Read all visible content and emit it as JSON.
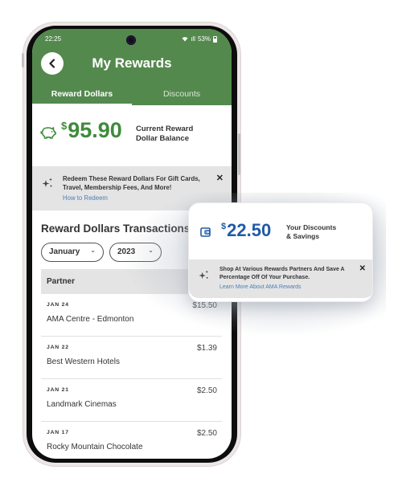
{
  "status_bar": {
    "time": "22:25",
    "signal": "ıll",
    "battery_pct": "53%"
  },
  "header": {
    "title": "My Rewards",
    "back_icon": "chevron-left-icon"
  },
  "tabs": [
    {
      "label": "Reward Dollars",
      "active": true
    },
    {
      "label": "Discounts",
      "active": false
    }
  ],
  "balance": {
    "currency": "$",
    "amount": "95.90",
    "label_line1": "Current Reward",
    "label_line2": "Dollar Balance",
    "icon": "piggy-bank-icon",
    "color": "#3f8b3b"
  },
  "banner": {
    "icon": "sparkle-icon",
    "text": "Redeem These Reward Dollars For Gift Cards, Travel, Membership Fees, And More!",
    "link": "How to Redeem",
    "close": "✕"
  },
  "transactions": {
    "title": "Reward Dollars Transactions",
    "filters": {
      "month": "January",
      "year": "2023"
    },
    "column_header": "Partner",
    "rows": [
      {
        "date": "JAN 24",
        "partner": "AMA Centre - Edmonton",
        "amount": "$15.50"
      },
      {
        "date": "JAN 22",
        "partner": "Best Western Hotels",
        "amount": "$1.39"
      },
      {
        "date": "JAN 21",
        "partner": "Landmark Cinemas",
        "amount": "$2.50"
      },
      {
        "date": "JAN 17",
        "partner": "Rocky Mountain Chocolate",
        "amount": "$2.50"
      }
    ]
  },
  "discount_card": {
    "icon": "wallet-icon",
    "currency": "$",
    "amount": "22.50",
    "label_line1": "Your Discounts",
    "label_line2": "& Savings",
    "color": "#1f5aa6",
    "banner_text": "Shop At Various Rewards Partners And Save A Percentage Off Of Your Purchase.",
    "banner_link": "Learn More About AMA Rewards",
    "close": "✕"
  }
}
